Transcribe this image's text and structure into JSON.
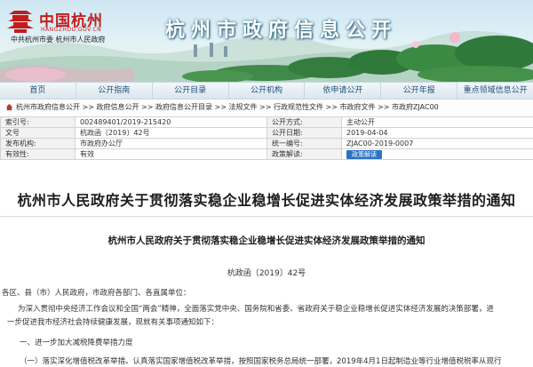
{
  "header": {
    "logo_name": "中国杭州",
    "logo_url": "HANGZHOU.GOV.CN",
    "logo_sub": "中共杭州市委  杭州市人民政府",
    "site_title": "杭州市政府信息公开"
  },
  "nav": {
    "items": [
      "首页",
      "公开指南",
      "公开目录",
      "公开机构",
      "依申请公开",
      "公开年报",
      "重点领域信息公开"
    ]
  },
  "breadcrumb": "杭州市政府信息公开 >> 政府信息公开 >> 政府信息公开目录 >> 法规文件 >> 行政规范性文件 >> 市政府文件 >> 市政府ZJAC00",
  "metadata": {
    "rows": [
      {
        "k1": "索引号:",
        "v1": "002489401/2019-215420",
        "k2": "公开方式:",
        "v2": "主动公开"
      },
      {
        "k1": "文号",
        "v1": "杭政函〔2019〕42号",
        "k2": "公开日期:",
        "v2": "2019-04-04"
      },
      {
        "k1": "发布机构:",
        "v1": "市政府办公厅",
        "k2": "统一编号:",
        "v2": "ZJAC00-2019-0007"
      },
      {
        "k1": "有效性:",
        "v1": "有效",
        "k2": "政策解读:",
        "v2": ""
      }
    ],
    "policy_button": "政策解读"
  },
  "document": {
    "title": "杭州市人民政府关于贯彻落实稳企业稳增长促进实体经济发展政策举措的通知",
    "subtitle": "杭州市人民政府关于贯彻落实稳企业稳增长促进实体经济发展政策举措的通知",
    "number": "杭政函〔2019〕42号",
    "paragraphs": [
      "各区、县（市）人民政府，市政府各部门、各直属单位：",
      "为深入贯彻中央经济工作会议和全国“两会”精神，全面落实党中央、国务院和省委、省政府关于稳企业稳增长促进实体经济发展的决策部署，进",
      "一步促进我市经济社会持续健康发展，现就有关事项通知如下：",
      "一、进一步加大减税降费举措力度",
      "（一）落实深化增值税改革举措。认真落实国家增值税改革举措，按照国家税务总局统一部署，2019年4月1日起制造业等行业增值税税率从现行"
    ]
  }
}
